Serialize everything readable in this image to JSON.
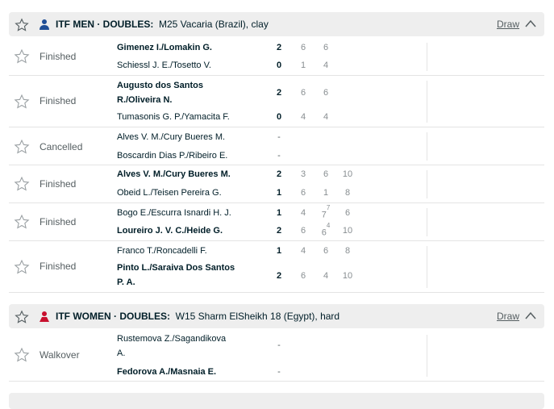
{
  "groups": [
    {
      "category": "ITF MEN · DOUBLES:",
      "tournament": "M25 Vacaria (Brazil), clay",
      "draw_label": "Draw",
      "flag_icon": "itf-men-icon",
      "matches": [
        {
          "status": "Finished",
          "players": [
            {
              "name": "Gimenez I./Lomakin G.",
              "winner": true,
              "total": "2",
              "sets": [
                "6",
                "6"
              ]
            },
            {
              "name": "Schiessl J. E./Tosetto V.",
              "winner": false,
              "total": "0",
              "sets": [
                "1",
                "4"
              ]
            }
          ]
        },
        {
          "status": "Finished",
          "players": [
            {
              "name_line1": "Augusto dos Santos",
              "name_line2": "R./Oliveira N.",
              "winner": true,
              "total": "2",
              "sets": [
                "6",
                "6"
              ]
            },
            {
              "name": "Tumasonis G. P./Yamacita F.",
              "winner": false,
              "total": "0",
              "sets": [
                "4",
                "4"
              ]
            }
          ]
        },
        {
          "status": "Cancelled",
          "players": [
            {
              "name": "Alves V. M./Cury Bueres M.",
              "winner": false,
              "total": "-",
              "sets": []
            },
            {
              "name": "Boscardin Dias P./Ribeiro E.",
              "winner": false,
              "total": "-",
              "sets": []
            }
          ]
        },
        {
          "status": "Finished",
          "players": [
            {
              "name": "Alves V. M./Cury Bueres M.",
              "winner": true,
              "total": "2",
              "sets": [
                "3",
                "6",
                "10"
              ]
            },
            {
              "name": "Obeid L./Teisen Pereira G.",
              "winner": false,
              "total": "1",
              "sets": [
                "6",
                "1",
                "8"
              ]
            }
          ]
        },
        {
          "status": "Finished",
          "players": [
            {
              "name": "Bogo E./Escurra Isnardi H. J.",
              "winner": false,
              "total": "1",
              "sets": [
                "4",
                "7",
                "6"
              ],
              "tiebreak": {
                "set": 1,
                "value": "7"
              }
            },
            {
              "name": "Loureiro J. V. C./Heide G.",
              "winner": true,
              "total": "2",
              "sets": [
                "6",
                "6",
                "10"
              ],
              "tiebreak": {
                "set": 1,
                "value": "4"
              }
            }
          ]
        },
        {
          "status": "Finished",
          "players": [
            {
              "name": "Franco T./Roncadelli F.",
              "winner": false,
              "total": "1",
              "sets": [
                "4",
                "6",
                "8"
              ]
            },
            {
              "name_line1": "Pinto L./Saraiva Dos Santos",
              "name_line2": "P. A.",
              "winner": true,
              "total": "2",
              "sets": [
                "6",
                "4",
                "10"
              ]
            }
          ]
        }
      ]
    },
    {
      "category": "ITF WOMEN · DOUBLES:",
      "tournament": "W15 Sharm ElSheikh 18 (Egypt), hard",
      "draw_label": "Draw",
      "flag_icon": "itf-women-icon",
      "matches": [
        {
          "status": "Walkover",
          "players": [
            {
              "name_line1": "Rustemova Z./Sagandikova",
              "name_line2": "A.",
              "winner": false,
              "total": "-",
              "sets": []
            },
            {
              "name": "Fedorova A./Masnaia E.",
              "winner": true,
              "total": "-",
              "sets": []
            }
          ]
        }
      ]
    }
  ],
  "colors": {
    "header_bg": "#eeeeee",
    "text": "#001e28",
    "muted": "#888e91",
    "men_icon": "#1f4e96",
    "women_icon": "#c8102e"
  }
}
